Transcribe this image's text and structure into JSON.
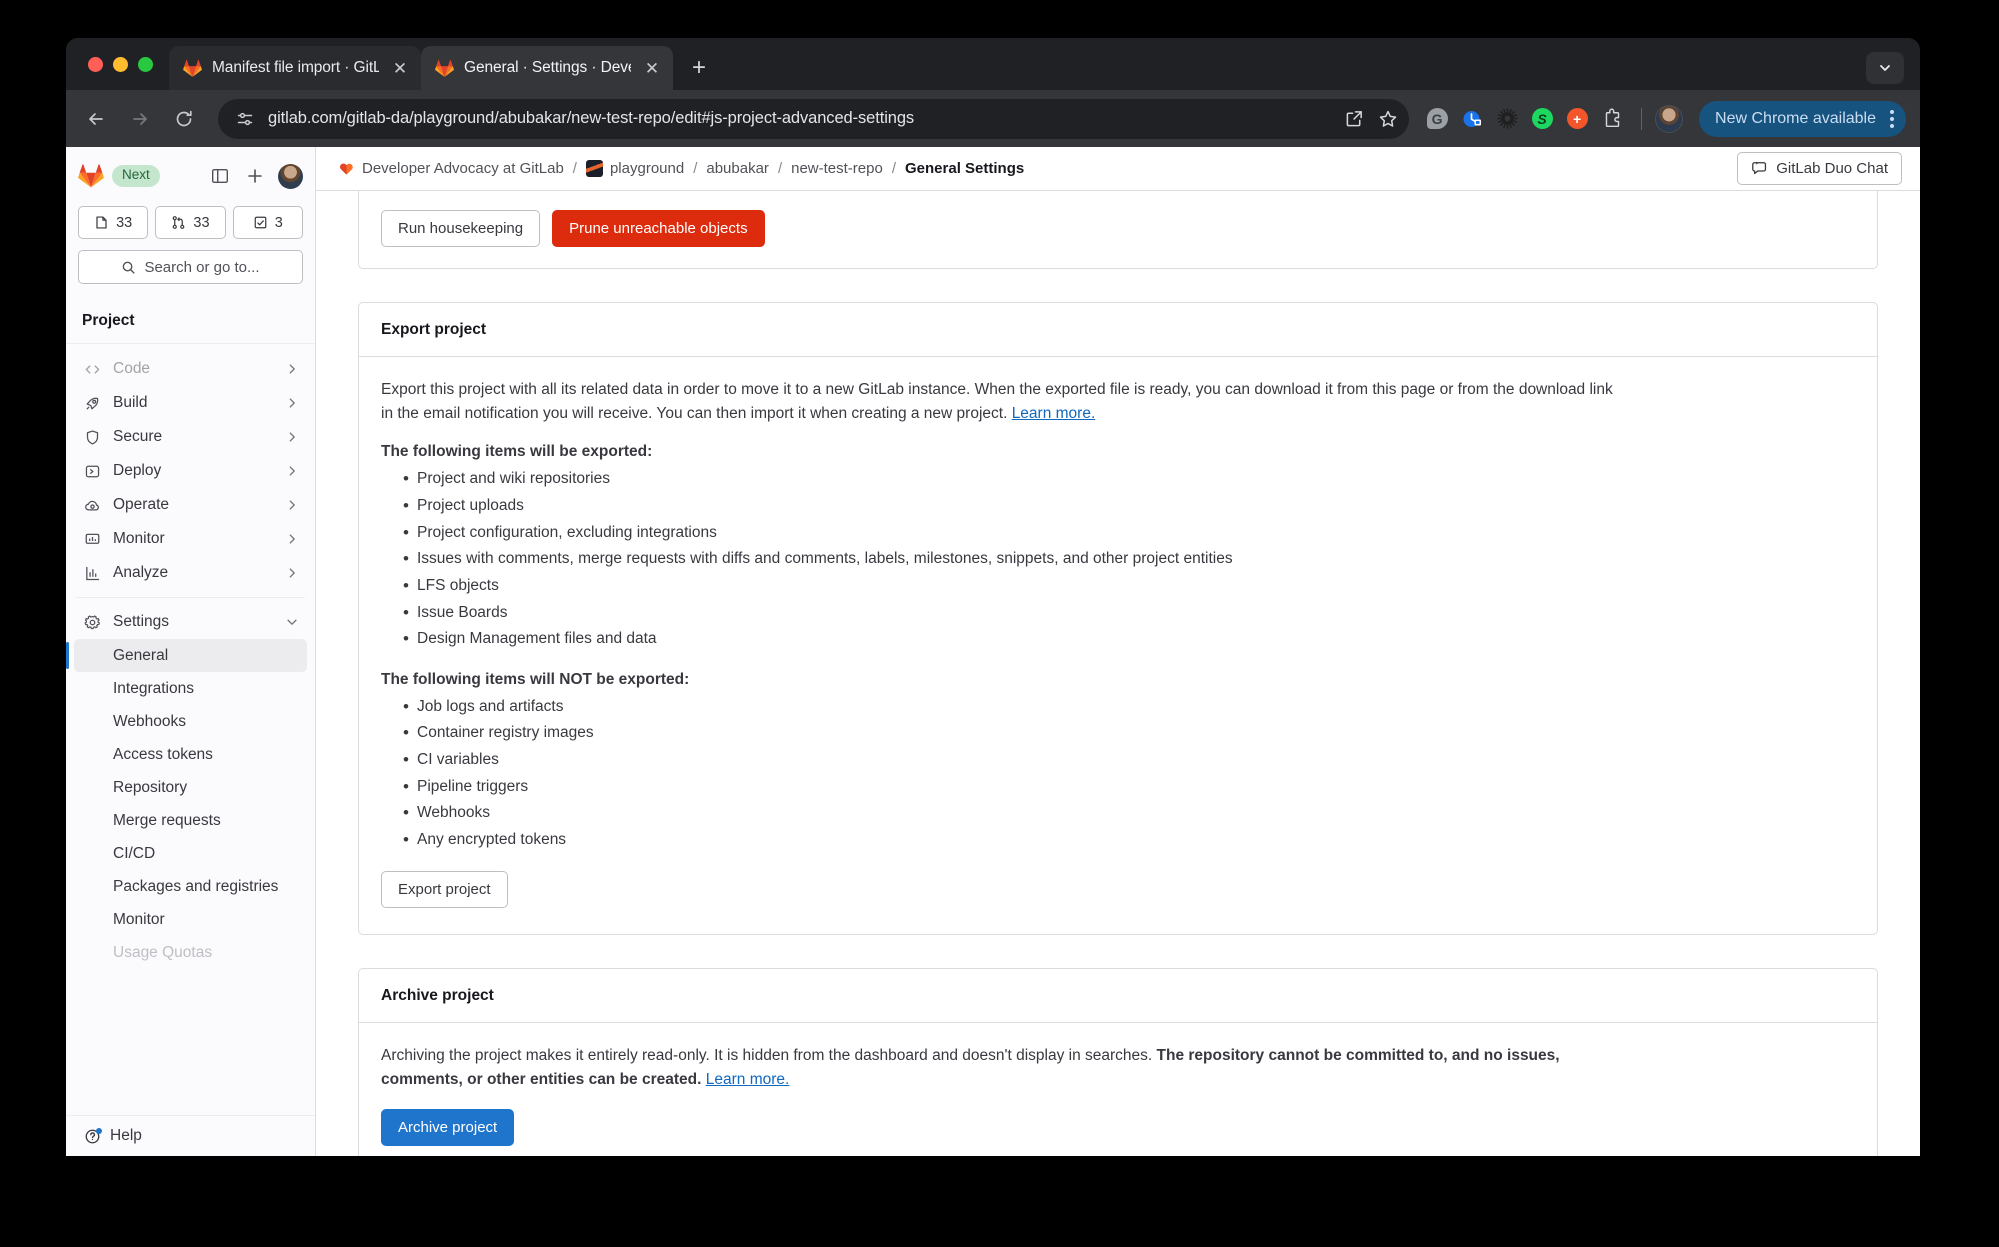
{
  "browser": {
    "tabs": [
      {
        "title": "Manifest file import · GitLab",
        "active": false
      },
      {
        "title": "General · Settings · Developer",
        "active": true
      }
    ],
    "new_tab_label": "+",
    "close_label": "✕",
    "url": "gitlab.com/gitlab-da/playground/abubakar/new-test-repo/edit#js-project-advanced-settings",
    "chrome_update_label": "New Chrome available",
    "extensions": [
      {
        "name": "grammarly-extension",
        "letter": "G",
        "color": "#9aa0a6"
      },
      {
        "name": "time-tracker-extension",
        "letter": "",
        "color": "#1a73e8"
      },
      {
        "name": "gear-extension",
        "letter": "",
        "color": "#1f1f1f"
      },
      {
        "name": "spotify-extension",
        "letter": "S",
        "color": "#1ed760"
      },
      {
        "name": "add-extension",
        "letter": "+",
        "color": "#f2562a"
      }
    ]
  },
  "gitlab": {
    "badge": "Next",
    "counts": [
      {
        "name": "issues",
        "value": "33"
      },
      {
        "name": "merge-requests",
        "value": "33"
      },
      {
        "name": "todos",
        "value": "3"
      }
    ],
    "search_placeholder": "Search or go to...",
    "section_title": "Project",
    "nav": [
      {
        "label": "Code",
        "icon": "code-icon",
        "muted": true,
        "expandable": true
      },
      {
        "label": "Build",
        "icon": "rocket-icon",
        "muted": false,
        "expandable": true
      },
      {
        "label": "Secure",
        "icon": "shield-icon",
        "muted": false,
        "expandable": true
      },
      {
        "label": "Deploy",
        "icon": "deploy-icon",
        "muted": false,
        "expandable": true
      },
      {
        "label": "Operate",
        "icon": "cloud-icon",
        "muted": false,
        "expandable": true
      },
      {
        "label": "Monitor",
        "icon": "monitor-icon",
        "muted": false,
        "expandable": true
      },
      {
        "label": "Analyze",
        "icon": "chart-icon",
        "muted": false,
        "expandable": true
      }
    ],
    "settings": {
      "label": "Settings",
      "icon": "gear-icon",
      "expanded": true
    },
    "settings_items": [
      {
        "label": "General",
        "active": true,
        "muted": false
      },
      {
        "label": "Integrations",
        "active": false,
        "muted": false
      },
      {
        "label": "Webhooks",
        "active": false,
        "muted": false
      },
      {
        "label": "Access tokens",
        "active": false,
        "muted": false
      },
      {
        "label": "Repository",
        "active": false,
        "muted": false
      },
      {
        "label": "Merge requests",
        "active": false,
        "muted": false
      },
      {
        "label": "CI/CD",
        "active": false,
        "muted": false
      },
      {
        "label": "Packages and registries",
        "active": false,
        "muted": false
      },
      {
        "label": "Monitor",
        "active": false,
        "muted": false
      },
      {
        "label": "Usage Quotas",
        "active": false,
        "muted": true
      }
    ],
    "help_label": "Help",
    "breadcrumb": [
      {
        "label": "Developer Advocacy at GitLab",
        "icon": "heart-avatar",
        "current": false
      },
      {
        "label": "playground",
        "icon": "tile-avatar",
        "current": false
      },
      {
        "label": "abubakar",
        "icon": "",
        "current": false
      },
      {
        "label": "new-test-repo",
        "icon": "",
        "current": false
      },
      {
        "label": "General Settings",
        "icon": "",
        "current": true
      }
    ],
    "breadcrumb_separator": "/",
    "duo_chat_label": "GitLab Duo Chat"
  },
  "housekeeping": {
    "run_label": "Run housekeeping",
    "prune_label": "Prune unreachable objects"
  },
  "export_project": {
    "title": "Export project",
    "description_lead": "Export this project with all its related data in order to move it to a new GitLab instance. When the exported file is ready, you can download it from this page or from the download link in the email notification you will receive. You can then import it when creating a new project.",
    "description_link": "Learn more.",
    "included_heading": "The following items will be exported:",
    "included_items": [
      "Project and wiki repositories",
      "Project uploads",
      "Project configuration, excluding integrations",
      "Issues with comments, merge requests with diffs and comments, labels, milestones, snippets, and other project entities",
      "LFS objects",
      "Issue Boards",
      "Design Management files and data"
    ],
    "excluded_heading": "The following items will NOT be exported:",
    "excluded_items": [
      "Job logs and artifacts",
      "Container registry images",
      "CI variables",
      "Pipeline triggers",
      "Webhooks",
      "Any encrypted tokens"
    ],
    "button_label": "Export project"
  },
  "archive_project": {
    "title": "Archive project",
    "description_part1": "Archiving the project makes it entirely read-only. It is hidden from the dashboard and doesn't display in searches.",
    "description_bold": "The repository cannot be committed to, and no issues, comments, or other entities can be created.",
    "description_link": "Learn more.",
    "button_label": "Archive project"
  },
  "colors": {
    "accent_blue": "#1f75cb",
    "danger_red": "#dd2b0e",
    "link_blue": "#1068bf",
    "badge_green": "#c3e6cd",
    "chrome_dark": "#202124"
  }
}
